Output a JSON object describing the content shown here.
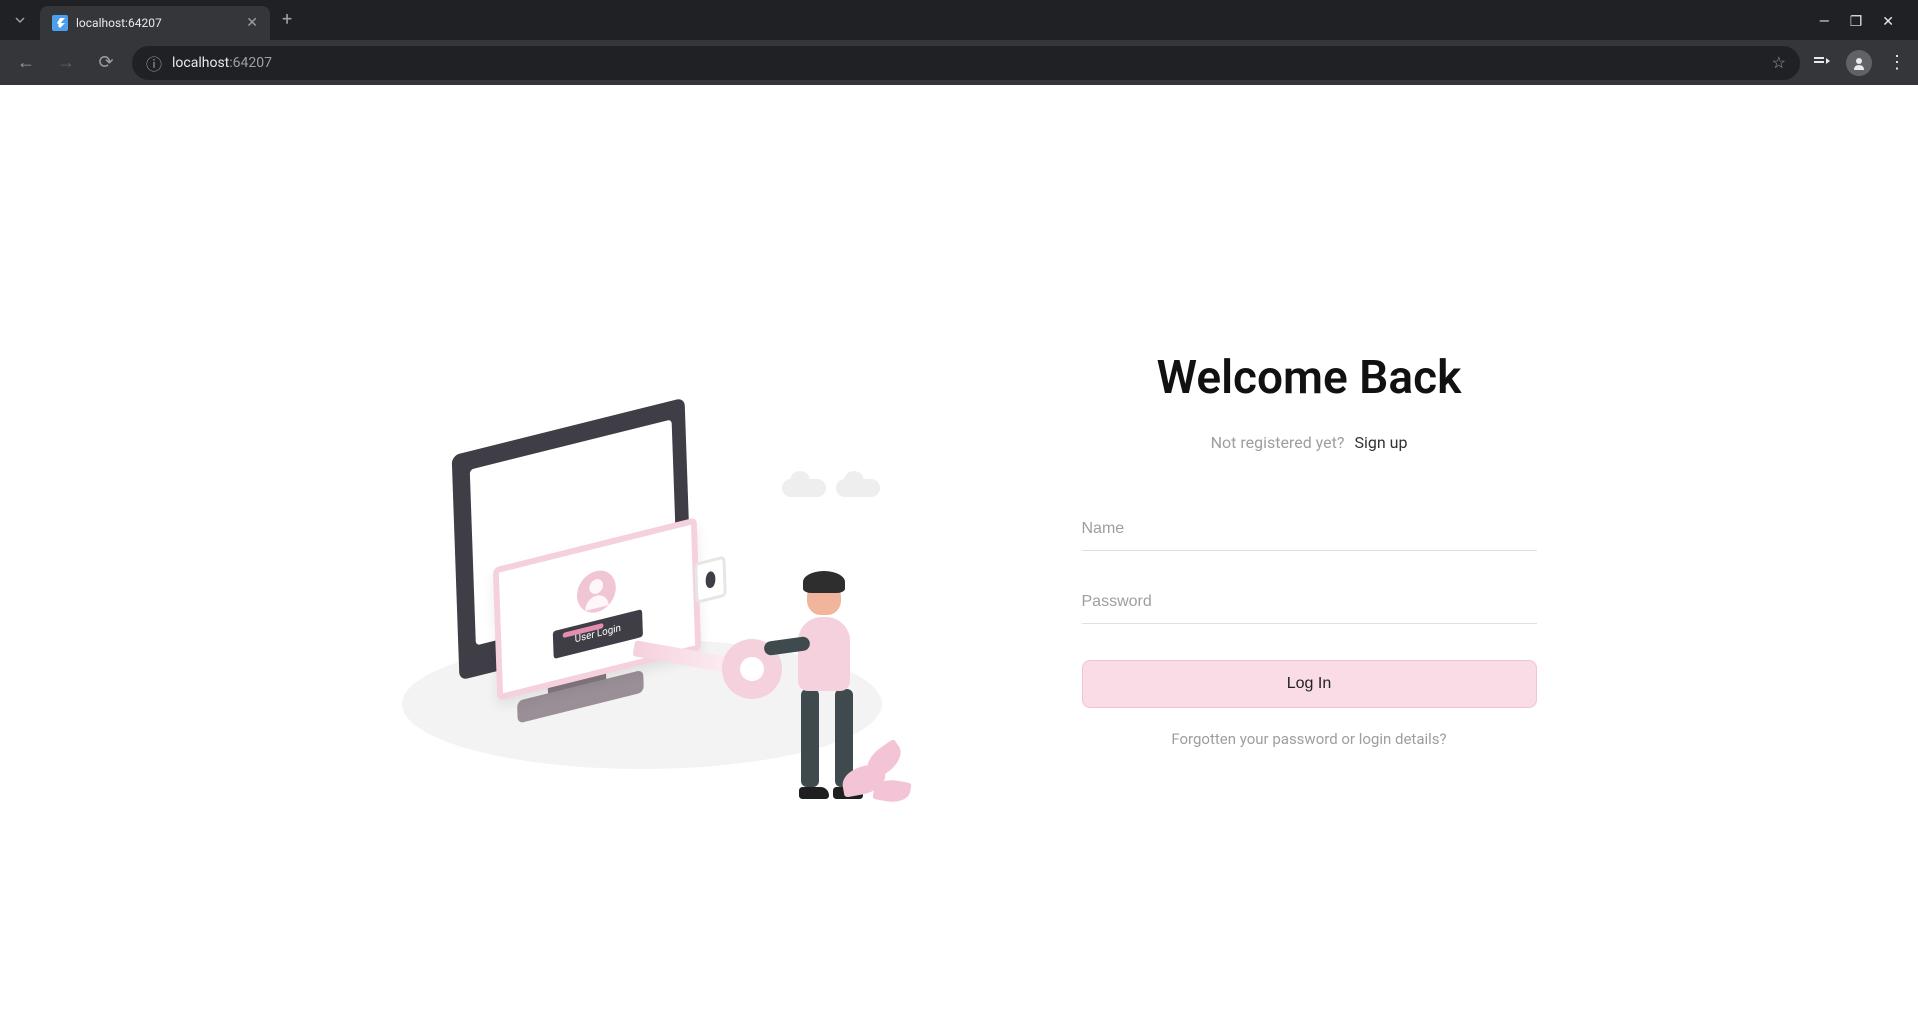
{
  "browser": {
    "tab_title": "localhost:64207",
    "url_host": "localhost",
    "url_port": ":64207"
  },
  "illustration": {
    "button_label": "User Login"
  },
  "login": {
    "title": "Welcome Back",
    "not_registered": "Not registered yet?",
    "signup": "Sign up",
    "name_placeholder": "Name",
    "password_placeholder": "Password",
    "login_button": "Log In",
    "forgot": "Forgotten your password or login details?"
  }
}
